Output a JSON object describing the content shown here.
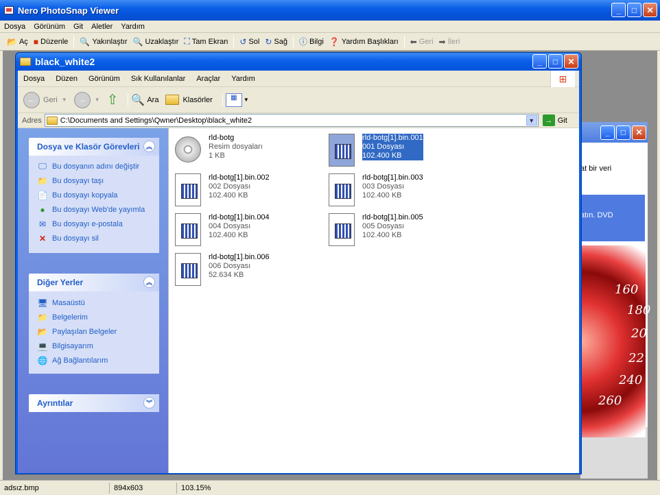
{
  "outer": {
    "title": "Nero PhotoSnap Viewer",
    "menu": [
      "Dosya",
      "Görünüm",
      "Git",
      "Aletler",
      "Yardım"
    ],
    "toolbar": {
      "ac": "Aç",
      "duzenle": "Düzenle",
      "yakinlastir": "Yakınlaştır",
      "uzaklastir": "Uzaklaştır",
      "tam_ekran": "Tam Ekran",
      "sol": "Sol",
      "sag": "Sağ",
      "bilgi": "Bilgi",
      "yardim": "Yardım Başlıkları",
      "geri": "Geri",
      "ileri": "İleri"
    },
    "status": {
      "file": "adsız.bmp",
      "dims": "894x603",
      "zoom": "103.15%"
    }
  },
  "background_window": {
    "text1": "at bir veri",
    "text2": "atın. DVD",
    "speed_labels": [
      "160",
      "180",
      "20",
      "22",
      "240",
      "260"
    ]
  },
  "explorer": {
    "title": "black_white2",
    "menu": [
      "Dosya",
      "Düzen",
      "Görünüm",
      "Sık Kullanılanlar",
      "Araçlar",
      "Yardım"
    ],
    "toolbar": {
      "geri": "Geri",
      "ara": "Ara",
      "klasorler": "Klasörler"
    },
    "address": {
      "label": "Adres",
      "path": "C:\\Documents and Settings\\Qwner\\Desktop\\black_white2",
      "go": "Git"
    },
    "tasks": {
      "title": "Dosya ve Klasör Görevleri",
      "items": [
        "Bu dosyanın adını değiştir",
        "Bu dosyayı taşı",
        "Bu dosyayı kopyala",
        "Bu dosyayı Web'de yayımla",
        "Bu dosyayı e-postala",
        "Bu dosyayı sil"
      ]
    },
    "places": {
      "title": "Diğer Yerler",
      "items": [
        "Masaüstü",
        "Belgelerim",
        "Paylaşılan Belgeler",
        "Bilgisayarım",
        "Ağ Bağlantılarım"
      ]
    },
    "details": {
      "title": "Ayrıntılar"
    },
    "files": [
      {
        "name": "rld-botg",
        "type": "Resim dosyaları",
        "size": "1 KB"
      },
      {
        "name": "rld-botg[1].bin.001",
        "type": "001 Dosyası",
        "size": "102.400 KB"
      },
      {
        "name": "rld-botg[1].bin.002",
        "type": "002 Dosyası",
        "size": "102.400 KB"
      },
      {
        "name": "rld-botg[1].bin.003",
        "type": "003 Dosyası",
        "size": "102.400 KB"
      },
      {
        "name": "rld-botg[1].bin.004",
        "type": "004 Dosyası",
        "size": "102.400 KB"
      },
      {
        "name": "rld-botg[1].bin.005",
        "type": "005 Dosyası",
        "size": "102.400 KB"
      },
      {
        "name": "rld-botg[1].bin.006",
        "type": "006 Dosyası",
        "size": "52.634 KB"
      }
    ]
  }
}
